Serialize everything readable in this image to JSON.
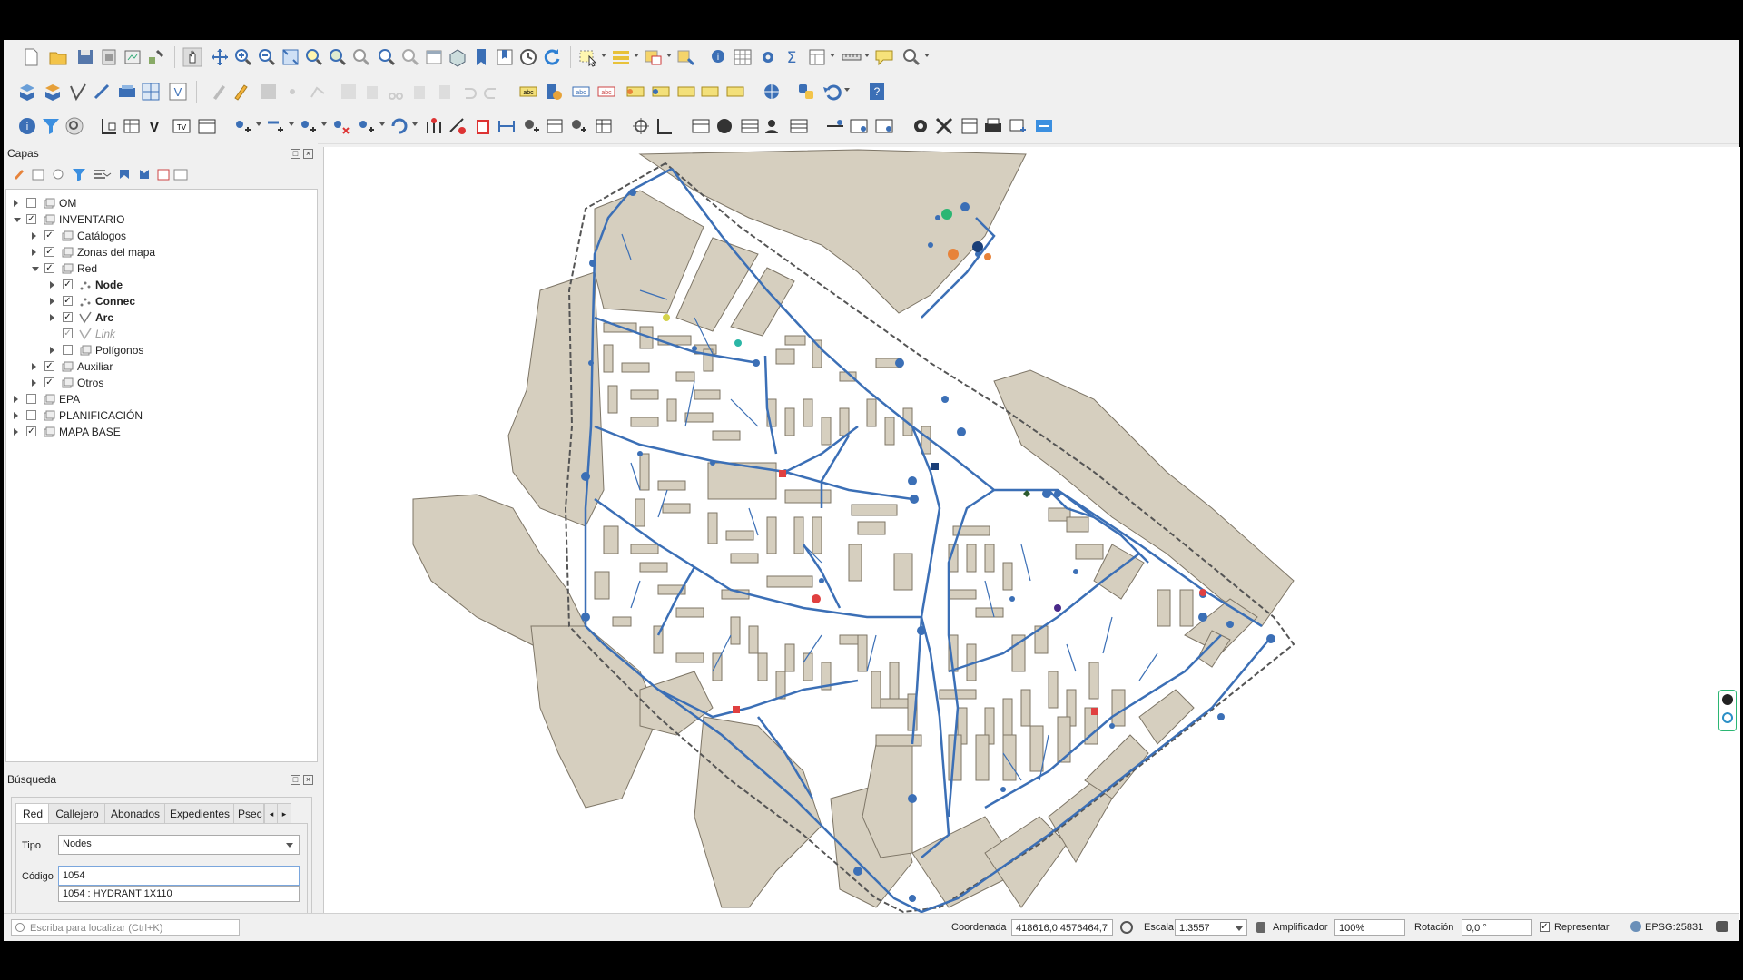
{
  "layers_panel": {
    "title": "Capas"
  },
  "layer_tree": [
    {
      "label": "OM",
      "checked": false,
      "bold": false,
      "italic": false
    },
    {
      "label": "INVENTARIO",
      "checked": true,
      "bold": false,
      "italic": false
    },
    {
      "label": "Catálogos",
      "checked": true,
      "bold": false,
      "italic": false
    },
    {
      "label": "Zonas del mapa",
      "checked": true,
      "bold": false,
      "italic": false
    },
    {
      "label": "Red",
      "checked": true,
      "bold": false,
      "italic": false
    },
    {
      "label": "Node",
      "checked": true,
      "bold": true,
      "italic": false
    },
    {
      "label": "Connec",
      "checked": true,
      "bold": true,
      "italic": false
    },
    {
      "label": "Arc",
      "checked": true,
      "bold": true,
      "italic": false
    },
    {
      "label": "Link",
      "checked": true,
      "bold": false,
      "italic": true
    },
    {
      "label": "Polígonos",
      "checked": false,
      "bold": false,
      "italic": false
    },
    {
      "label": "Auxiliar",
      "checked": true,
      "bold": false,
      "italic": false
    },
    {
      "label": "Otros",
      "checked": true,
      "bold": false,
      "italic": false
    },
    {
      "label": "EPA",
      "checked": false,
      "bold": false,
      "italic": false
    },
    {
      "label": "PLANIFICACIÓN",
      "checked": false,
      "bold": false,
      "italic": false
    },
    {
      "label": "MAPA BASE",
      "checked": true,
      "bold": false,
      "italic": false
    }
  ],
  "search_panel": {
    "title": "Búsqueda",
    "tabs": [
      "Red",
      "Callejero",
      "Abonados",
      "Expedientes",
      "Psec"
    ],
    "active_tab": "Red",
    "tipo_label": "Tipo",
    "tipo_value": "Nodes",
    "codigo_label": "Código",
    "codigo_value": "1054",
    "suggestion": "1054 : HYDRANT 1X110"
  },
  "statusbar": {
    "locator_placeholder": "Escriba para localizar (Ctrl+K)",
    "coord_label": "Coordenada",
    "coord_value": "418616,0 4576464,7",
    "scale_label": "Escala",
    "scale_value": "1:3557",
    "magnifier_label": "Amplificador",
    "magnifier_value": "100%",
    "rotation_label": "Rotación",
    "rotation_value": "0,0 °",
    "render_label": "Representar",
    "crs": "EPSG:25831"
  },
  "colors": {
    "pipe": "#3b6fb6",
    "building": "#d6cfbf",
    "building_stroke": "#7d7566",
    "hydrant": "#e04040",
    "accent_green": "#2bb673"
  }
}
